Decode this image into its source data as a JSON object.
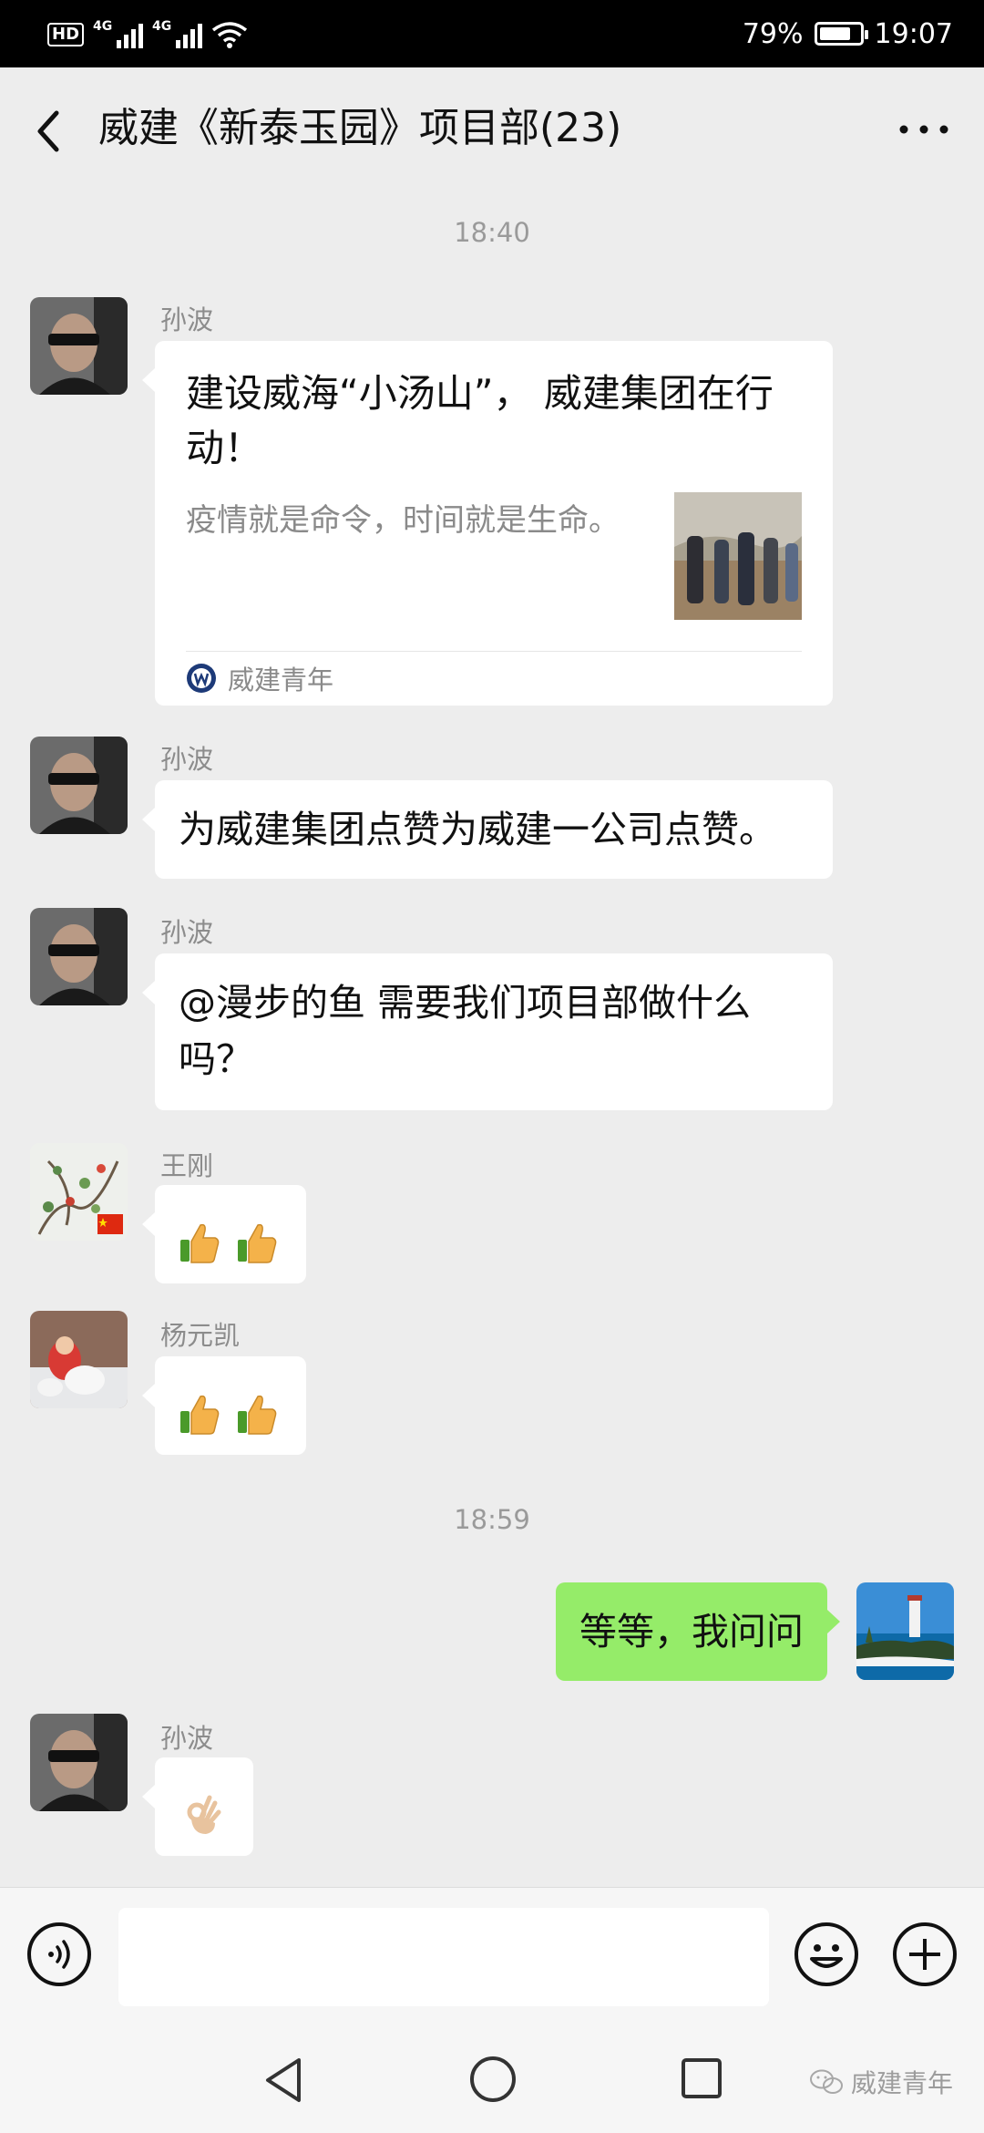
{
  "status_bar": {
    "hd": "HD",
    "network_1": "4G",
    "network_2": "4G",
    "battery_level": 0.79,
    "battery_text": "79%",
    "time": "19:07"
  },
  "header": {
    "back_icon": "chevron-left-icon",
    "title": "威建《新泰玉园》项目部(23)",
    "more_icon": "more-dots-icon"
  },
  "messages": [
    {
      "kind": "time",
      "text": "18:40"
    },
    {
      "kind": "link-card",
      "sender": "孙波",
      "card_title": "建设威海“小汤山”， 威建集团在行动！",
      "card_desc": "疫情就是命令，时间就是生命。",
      "card_source": "威建青年"
    },
    {
      "kind": "text",
      "sender": "孙波",
      "text": "为威建集团点赞为威建一公司点赞。"
    },
    {
      "kind": "text",
      "sender": "孙波",
      "text_line1": "@漫步的鱼  需要我们项目部做什么",
      "text_line2": "吗？"
    },
    {
      "kind": "emoji",
      "sender": "王刚",
      "emoji": "thumbs-up-icon x2"
    },
    {
      "kind": "emoji",
      "sender": "杨元凯",
      "emoji": "thumbs-up-icon x2"
    },
    {
      "kind": "time",
      "text": "18:59"
    },
    {
      "kind": "text",
      "sender": "me",
      "text": "等等，我问问"
    },
    {
      "kind": "emoji",
      "sender": "孙波",
      "emoji": "ok-hand-icon"
    }
  ],
  "input_bar": {
    "voice_icon": "voice-icon",
    "text_value": "",
    "emoji_icon": "smile-icon",
    "plus_icon": "plus-icon"
  },
  "nav_bar": {
    "back_icon": "nav-back-icon",
    "home_icon": "nav-home-icon",
    "recent_icon": "nav-recent-icon"
  },
  "watermark": {
    "text": "威建青年"
  },
  "colors": {
    "background": "#ededed",
    "my_bubble": "#95ec69",
    "other_bubble": "#ffffff",
    "meta_text": "#9a9a9a"
  }
}
